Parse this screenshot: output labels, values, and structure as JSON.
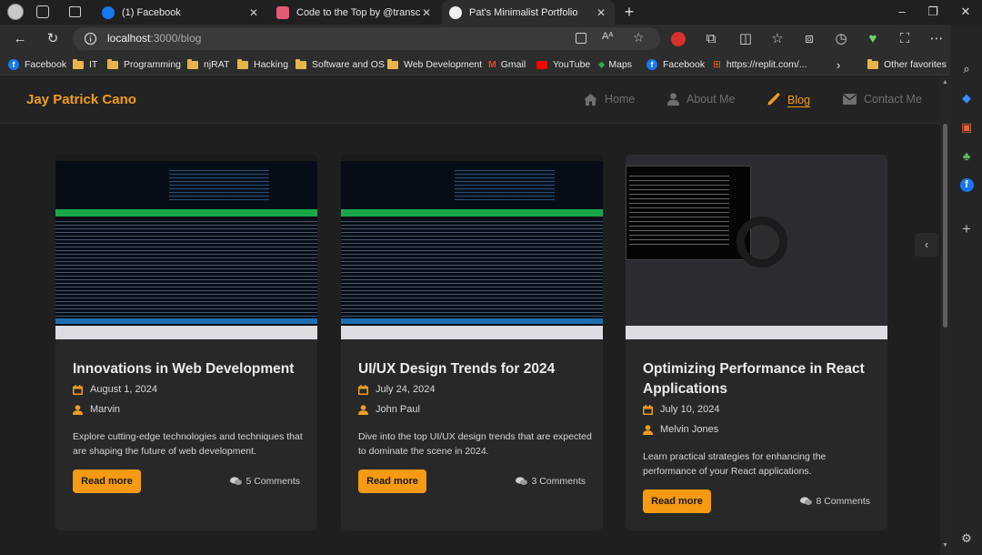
{
  "browser": {
    "tabs": [
      {
        "title": "(1) Facebook",
        "active": false
      },
      {
        "title": "Code to the Top by @transcende",
        "active": false
      },
      {
        "title": "Pat's Minimalist Portfolio",
        "active": true
      }
    ],
    "address": {
      "host": "localhost",
      "path": ":3000/blog"
    },
    "favorites": [
      "Facebook",
      "IT",
      "Programming",
      "njRAT",
      "Hacking",
      "Software and OS",
      "Web Development",
      "Gmail",
      "YouTube",
      "Maps",
      "Facebook",
      "https://replit.com/...",
      "Other favorites"
    ]
  },
  "site": {
    "brand": "Jay Patrick Cano",
    "nav": [
      {
        "label": "Home",
        "icon": "home-icon",
        "active": false
      },
      {
        "label": "About Me",
        "icon": "user-icon",
        "active": false
      },
      {
        "label": "Blog",
        "icon": "pen-icon",
        "active": true
      },
      {
        "label": "Contact Me",
        "icon": "envelope-icon",
        "active": false
      }
    ]
  },
  "posts": [
    {
      "title": "Innovations in Web Development",
      "date": "August 1, 2024",
      "author": "Marvin",
      "excerpt": "Explore cutting-edge technologies and techniques that are shaping the future of web development.",
      "read_more": "Read more",
      "comments": "5 Comments"
    },
    {
      "title": "UI/UX Design Trends for 2024",
      "date": "July 24, 2024",
      "author": "John Paul",
      "excerpt": "Dive into the top UI/UX design trends that are expected to dominate the scene in 2024.",
      "read_more": "Read more",
      "comments": "3 Comments"
    },
    {
      "title": "Optimizing Performance in React Applications",
      "date": "July 10, 2024",
      "author": "Melvin Jones",
      "excerpt": "Learn practical strategies for enhancing the performance of your React applications.",
      "read_more": "Read more",
      "comments": "8 Comments"
    }
  ],
  "colors": {
    "accent": "#f59a12",
    "background": "#1f1f1f",
    "card": "#282828"
  }
}
